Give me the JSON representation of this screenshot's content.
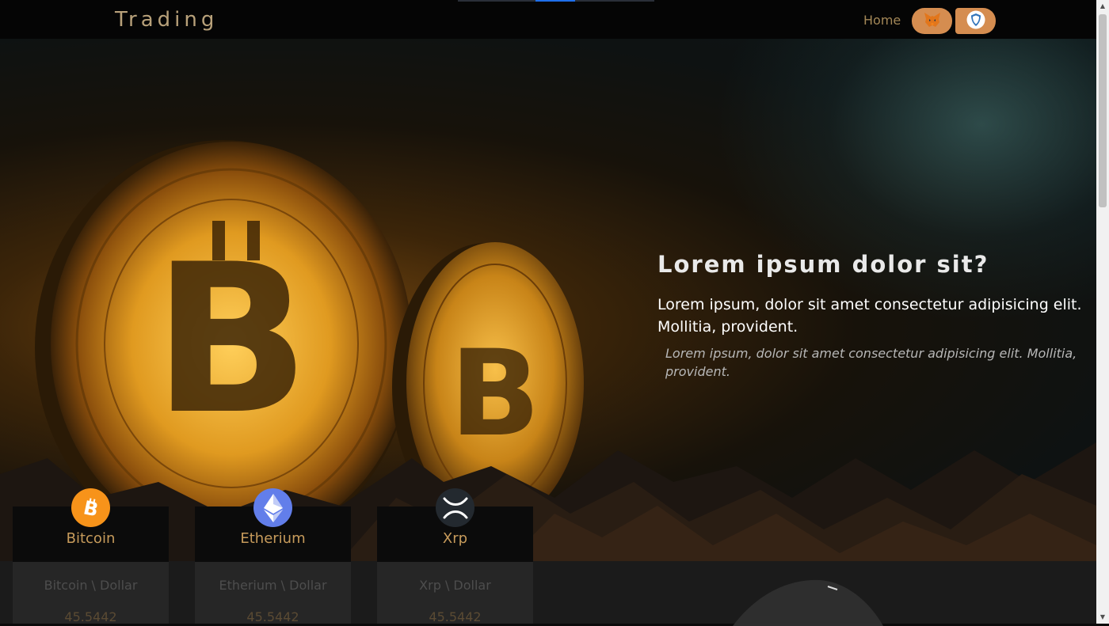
{
  "navbar": {
    "brand": "Trading",
    "home_label": "Home",
    "wallet_icons": [
      "metamask-fox-icon",
      "trust-wallet-shield-icon"
    ]
  },
  "hero": {
    "title": "Lorem ipsum dolor sit?",
    "subtitle": "Lorem ipsum, dolor sit amet consectetur adipisicing elit. Mollitia, provident.",
    "italic": "Lorem ipsum, dolor sit amet consectetur adipisicing elit. Mollitia, provident."
  },
  "cards": [
    {
      "name": "Bitcoin",
      "pair": "Bitcoin \\ Dollar",
      "price": "45.5442",
      "icon": "bitcoin-icon",
      "icon_color": "#f7931a"
    },
    {
      "name": "Etherium",
      "pair": "Etherium \\ Dollar",
      "price": "45.5442",
      "icon": "ethereum-icon",
      "icon_color": "#627eea"
    },
    {
      "name": "Xrp",
      "pair": "Xrp \\ Dollar",
      "price": "45.5442",
      "icon": "xrp-icon",
      "icon_color": "#23292f"
    }
  ],
  "colors": {
    "accent": "#d58d50",
    "brand_text": "#b8a17a",
    "card_title": "#c79b5b"
  }
}
